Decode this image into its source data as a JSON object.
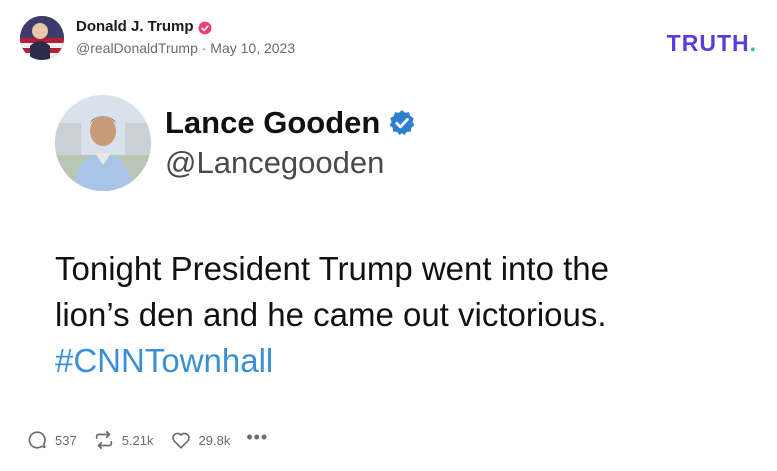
{
  "author": {
    "name": "Donald J. Trump",
    "handle_date": "@realDonaldTrump · May 10, 2023"
  },
  "brand": {
    "logo_text": "TRUTH",
    "logo_dot": ".",
    "color": "#5b3dd8",
    "dot_color": "#11c8b8"
  },
  "quoted": {
    "name": "Lance Gooden",
    "handle": "@Lancegooden",
    "lines": [
      "Tonight President Trump went into the",
      "lion’s den and he came out victorious."
    ],
    "hashtag": "#CNNTownhall",
    "hashtag_color": "#3b8fd6"
  },
  "actions": {
    "replies": "537",
    "retruths": "5.21k",
    "likes": "29.8k",
    "more": "•••"
  },
  "icons": {
    "verified_small": "verified-badge-icon",
    "verified_large": "verified-badge-icon",
    "reply": "reply-icon",
    "retruth": "retruth-icon",
    "like": "heart-icon",
    "more": "more-icon"
  }
}
